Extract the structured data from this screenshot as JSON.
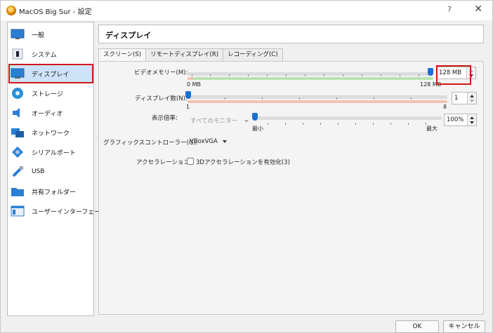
{
  "window": {
    "title": "MacOS Big Sur - 設定",
    "help_glyph": "?",
    "close_glyph": "✕"
  },
  "sidebar": {
    "items": [
      {
        "label": "一般",
        "icon": "monitor-general-icon"
      },
      {
        "label": "システム",
        "icon": "chip-icon"
      },
      {
        "label": "ディスプレイ",
        "icon": "display-icon",
        "selected": true
      },
      {
        "label": "ストレージ",
        "icon": "disk-icon"
      },
      {
        "label": "オーディオ",
        "icon": "speaker-icon"
      },
      {
        "label": "ネットワーク",
        "icon": "network-icon"
      },
      {
        "label": "シリアルポート",
        "icon": "serial-port-icon"
      },
      {
        "label": "USB",
        "icon": "usb-icon"
      },
      {
        "label": "共有フォルダー",
        "icon": "shared-folder-icon"
      },
      {
        "label": "ユーザーインターフェース",
        "icon": "user-interface-icon"
      }
    ]
  },
  "main": {
    "header": "ディスプレイ",
    "tabs": [
      {
        "label": "スクリーン(S)",
        "active": true
      },
      {
        "label": "リモートディスプレイ(R)"
      },
      {
        "label": "レコーディング(C)"
      }
    ],
    "video_memory": {
      "label": "ビデオメモリー(M):",
      "min_label": "0 MB",
      "max_label": "128 MB",
      "value": "128 MB",
      "fraction": 1.0
    },
    "monitor_count": {
      "label": "ディスプレイ数(N):",
      "min_label": "1",
      "max_label": "8",
      "value": "1",
      "fraction": 0.0
    },
    "scale_factor": {
      "label": "表示倍率:",
      "monitor_select": "すべてのモニター",
      "min_label": "最小",
      "max_label": "最大",
      "value": "100%",
      "fraction": 0.0
    },
    "graphics_controller": {
      "label": "グラフィックスコントローラー(G):",
      "value": "VBoxVGA"
    },
    "acceleration": {
      "label": "アクセラレーション:",
      "checkbox_label": "3Dアクセラレーションを有効化(3)",
      "checked": false
    }
  },
  "buttons": {
    "ok": "OK",
    "cancel": "キャンセル"
  },
  "colors": {
    "accent": "#1a6fd0",
    "highlight": "#d01717",
    "slider_good": "#b9e3b0",
    "slider_bad": "#f2c2b1",
    "slider_neutral": "#dcdcdc"
  }
}
